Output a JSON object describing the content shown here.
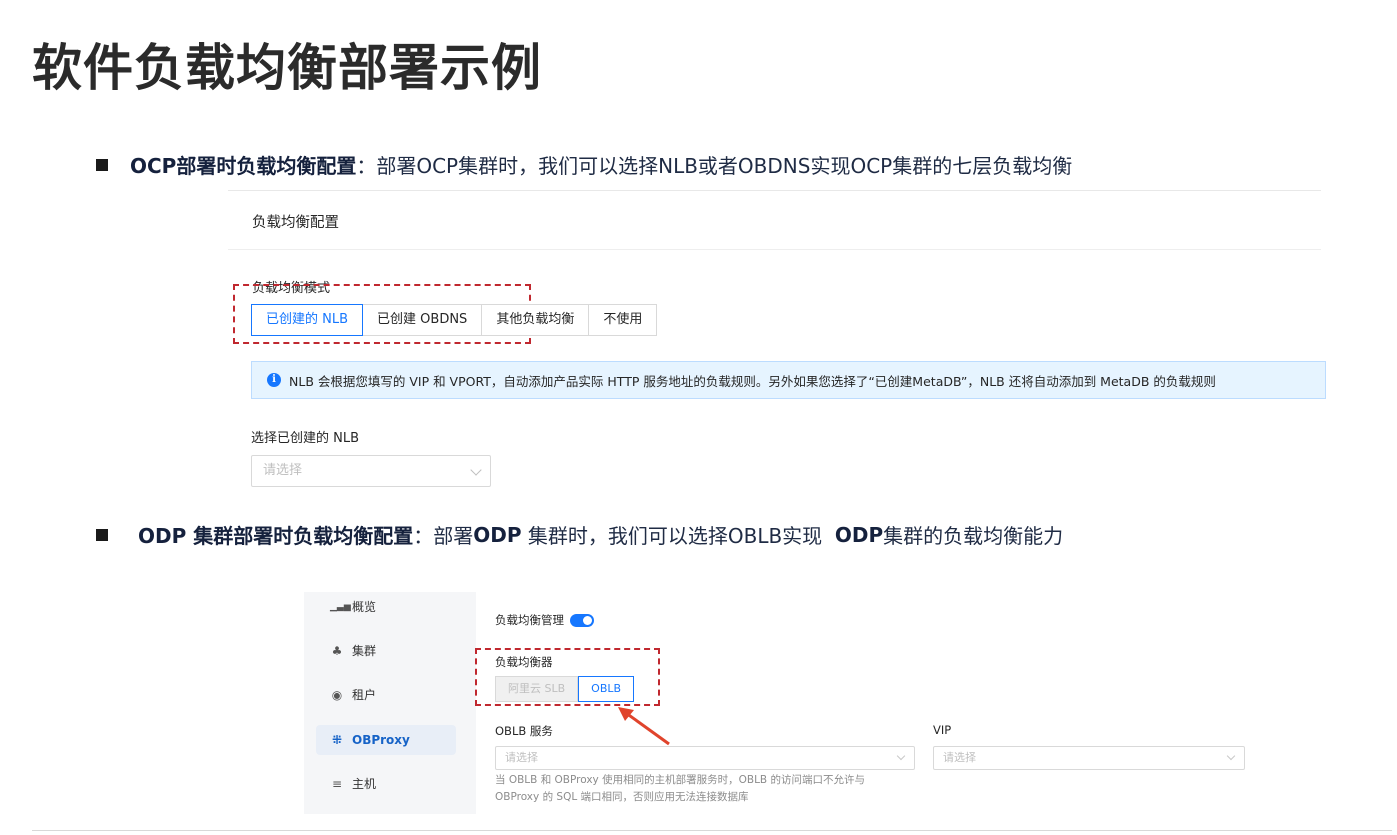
{
  "title": "软件负载均衡部署示例",
  "bullet1": {
    "bold": "OCP部署时负载均衡配置",
    "text": "：部署OCP集群时，我们可以选择NLB或者OBDNS实现OCP集群的七层负载均衡"
  },
  "screenshot1": {
    "header": "负载均衡配置",
    "mode_label": "负载均衡模式",
    "modes": [
      "已创建的 NLB",
      "已创建 OBDNS",
      "其他负载均衡",
      "不使用"
    ],
    "selected_mode": "已创建的 NLB",
    "info_icon": "info-icon",
    "alert": "NLB 会根据您填写的 VIP 和 VPORT，自动添加产品实际 HTTP 服务地址的负载规则。另外如果您选择了“已创建MetaDB”，NLB 还将自动添加到 MetaDB 的负载规则",
    "select_label": "选择已创建的 NLB",
    "select_placeholder": "请选择"
  },
  "bullet2": {
    "bold": "ODP 集群部署时负载均衡配置",
    "text_a": "：部署 ",
    "bold2": "ODP",
    "text_b": " 集群时，我们可以选择OBLB实现  ",
    "bold3": "ODP",
    "text_c": " 集群的负载均衡能力"
  },
  "screenshot2": {
    "sidebar": [
      {
        "icon": "bar-chart-icon",
        "glyph": "▮",
        "label": "概览"
      },
      {
        "icon": "cluster-icon",
        "glyph": "♣",
        "label": "集群"
      },
      {
        "icon": "tenant-icon",
        "glyph": "◉",
        "label": "租户"
      },
      {
        "icon": "obproxy-icon",
        "glyph": "⁜",
        "label": "OBProxy"
      },
      {
        "icon": "host-icon",
        "glyph": "≡",
        "label": "主机"
      }
    ],
    "active_item": "OBProxy",
    "lb_management_label": "负载均衡管理",
    "lb_management_on": true,
    "lb_label": "负载均衡器",
    "lb_options": [
      "阿里云 SLB",
      "OBLB"
    ],
    "lb_selected": "OBLB",
    "oblb_service_label": "OBLB 服务",
    "oblb_placeholder": "请选择",
    "vip_label": "VIP",
    "vip_placeholder": "请选择",
    "hint_line1": "当 OBLB 和 OBProxy 使用相同的主机部署服务时，OBLB 的访问端口不允许与",
    "hint_line2": "OBProxy 的 SQL 端口相同，否则应用无法连接数据库"
  },
  "colors": {
    "accent": "#1677ff",
    "highlight_dash": "#c0282f",
    "alert_bg": "#e6f4ff"
  }
}
